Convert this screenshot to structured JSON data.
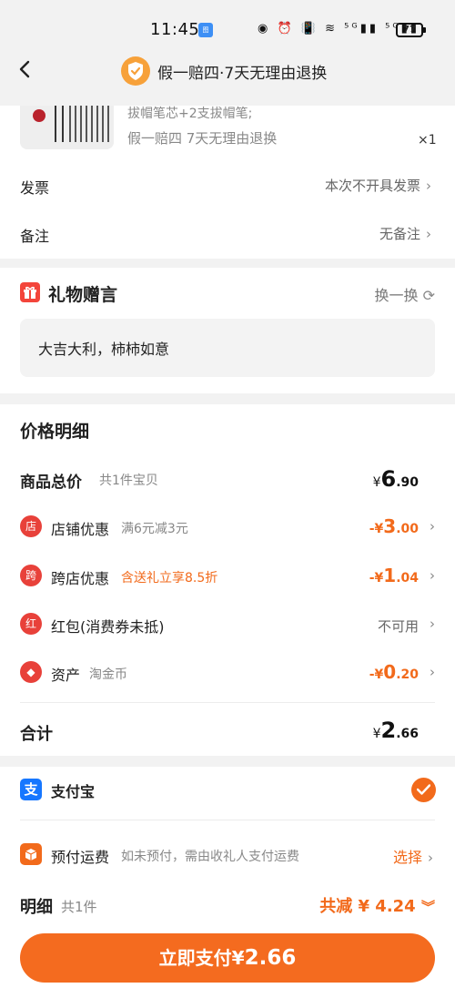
{
  "status_bar": {
    "time": "11:45",
    "app_badge": "图",
    "signal_icons": "◉ ⏰ 📳 ≋ ⁵ᴳ▮▮ ⁵ᴳ▮▮",
    "battery": "77"
  },
  "header": {
    "title": "假一赔四·7天无理由退换"
  },
  "product": {
    "desc": "拔帽笔芯+2支拔帽笔;",
    "guarantee": "假一赔四  7天无理由退换",
    "qty": "×1"
  },
  "invoice": {
    "label": "发票",
    "value": "本次不开具发票"
  },
  "remark": {
    "label": "备注",
    "value": "无备注"
  },
  "gift": {
    "title": "礼物赠言",
    "swap_label": "换一换",
    "message": "大吉大利，柿柿如意"
  },
  "price": {
    "title": "价格明细",
    "goods_total": {
      "label": "商品总价",
      "sub": "共1件宝贝",
      "currency": "¥",
      "int": "6",
      "dec": ".90"
    },
    "shop_discount": {
      "label": "店铺优惠",
      "sub": "满6元减3元",
      "prefix": "-¥",
      "int": "3",
      "dec": ".00",
      "icon": "店"
    },
    "cross_discount": {
      "label": "跨店优惠",
      "sub": "含送礼立享8.5折",
      "prefix": "-¥",
      "int": "1",
      "dec": ".04",
      "icon": "跨"
    },
    "red_packet": {
      "label": "红包(消费券未抵)",
      "value": "不可用",
      "icon": "红"
    },
    "assets": {
      "label": "资产",
      "sub": "淘金币",
      "prefix": "-¥",
      "int": "0",
      "dec": ".20",
      "icon": "◆"
    },
    "total": {
      "label": "合计",
      "currency": "¥",
      "int": "2",
      "dec": ".66"
    }
  },
  "payment": {
    "alipay_icon": "支",
    "alipay_label": "支付宝",
    "prepay_label": "预付运费",
    "prepay_sub": "如未预付，需由收礼人支付运费",
    "prepay_action": "选择"
  },
  "detail": {
    "label": "明细",
    "count": "共1件",
    "saved": "共减 ¥ 4.24"
  },
  "pay_button": {
    "label": "立即支付¥",
    "amount": "2.66"
  },
  "colors": {
    "accent": "#f46b1f",
    "red": "#e8413a",
    "alipay": "#1677ff"
  }
}
